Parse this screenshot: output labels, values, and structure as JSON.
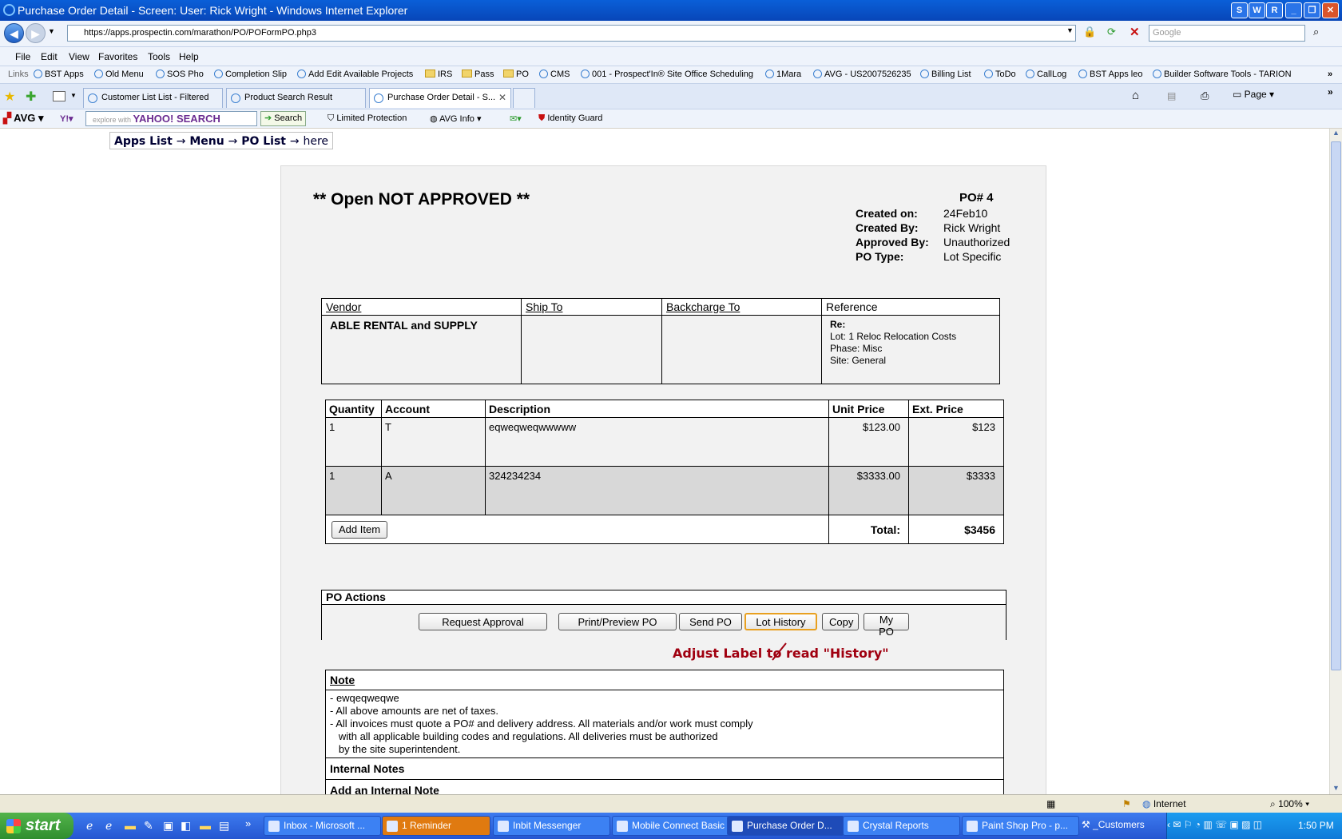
{
  "window": {
    "title": "Purchase Order Detail - Screen: User: Rick Wright - Windows Internet Explorer",
    "controls": [
      "S",
      "W",
      "R",
      "_",
      "❐",
      "✕"
    ]
  },
  "address": {
    "url": "https://apps.prospectin.com/marathon/PO/POFormPO.php3",
    "search_placeholder": "Google"
  },
  "menu": [
    "File",
    "Edit",
    "View",
    "Favorites",
    "Tools",
    "Help"
  ],
  "links": {
    "label": "Links",
    "items": [
      "BST Apps",
      "Old Menu",
      "SOS Pho",
      "Completion Slip",
      "Add Edit Available Projects",
      "IRS",
      "Pass",
      "PO",
      "CMS",
      "001 - Prospect'In® Site Office Scheduling",
      "1Mara",
      "AVG - US2007526235",
      "Billing List",
      "ToDo",
      "CallLog",
      "BST Apps leo",
      "Builder Software Tools - TARION"
    ]
  },
  "tabs": [
    {
      "label": "Customer List List - Filtered"
    },
    {
      "label": "Product Search Result"
    },
    {
      "label": "Purchase Order Detail - S..."
    }
  ],
  "command": {
    "page": "Page"
  },
  "avgbar": {
    "avg": "AVG",
    "search_hint": "explore with",
    "yahoo": "YAHOO! SEARCH",
    "search": "Search",
    "limited": "Limited Protection",
    "avginfo": "AVG Info",
    "identity": "Identity Guard"
  },
  "breadcrumb": {
    "apps": "Apps List",
    "menu": "Menu",
    "polist": "PO List",
    "here": "here",
    "sep": "→"
  },
  "po": {
    "status": "** Open NOT APPROVED **",
    "number": "PO# 4",
    "fields": [
      {
        "label": "Created on:",
        "value": "24Feb10"
      },
      {
        "label": "Created By:",
        "value": "Rick Wright"
      },
      {
        "label": "Approved By:",
        "value": "Unauthorized"
      },
      {
        "label": "PO Type:",
        "value": "Lot Specific"
      }
    ],
    "vendor_headers": [
      "Vendor",
      "Ship To",
      "Backcharge To",
      "Reference"
    ],
    "vendor": "ABLE RENTAL and SUPPLY",
    "ship_to": "",
    "backcharge_to": "",
    "reference": {
      "re": "Re:",
      "lot": "Lot: 1 Reloc Relocation Costs",
      "phase": "Phase: Misc",
      "site": "Site: General"
    },
    "item_headers": [
      "Quantity",
      "Account",
      "Description",
      "Unit Price",
      "Ext. Price"
    ],
    "items": [
      {
        "qty": "1",
        "account": "T",
        "description": "eqweqweqwwwww",
        "unit": "$123.00",
        "ext": "$123"
      },
      {
        "qty": "1",
        "account": "A",
        "description": "324234234",
        "unit": "$3333.00",
        "ext": "$3333"
      }
    ],
    "add_item": "Add Item",
    "total_label": "Total:",
    "total": "$3456"
  },
  "actions": {
    "header": "PO Actions",
    "request": "Request Approval",
    "print": "Print/Preview PO",
    "send": "Send PO",
    "lot_history": "Lot History",
    "copy": "Copy",
    "mypo": "My PO",
    "annotation": "Adjust Label to read \"History\""
  },
  "notes": {
    "header": "Note",
    "lines": [
      "- ewqeqweqwe",
      "- All above amounts are net of taxes.",
      "- All invoices must quote a PO# and delivery address. All materials and/or work must comply",
      "   with all applicable building codes and regulations. All deliveries must be authorized",
      "   by the site superintendent."
    ],
    "internal": "Internal Notes",
    "add_internal": "Add an Internal Note"
  },
  "status": {
    "zone": "Internet",
    "zoom": "100%"
  },
  "taskbar": {
    "start": "start",
    "tasks": [
      "Inbox - Microsoft ...",
      "1 Reminder",
      "Inbit Messenger",
      "Mobile Connect Basic",
      "Purchase Order D...",
      "Crystal Reports",
      "Paint Shop Pro - p..."
    ],
    "customers": "_Customers",
    "clock": "1:50 PM"
  }
}
